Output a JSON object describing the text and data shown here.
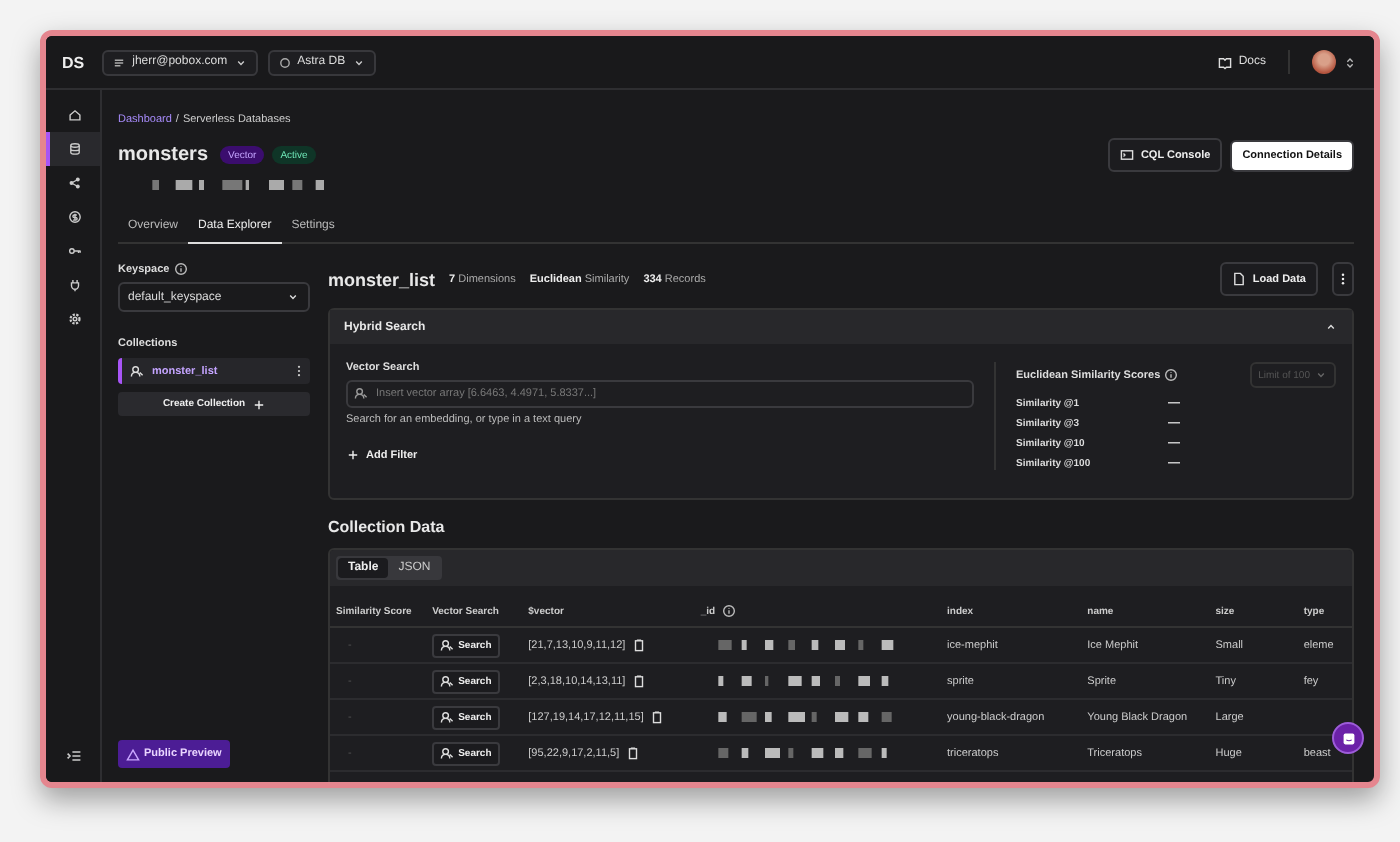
{
  "topbar": {
    "logo": "DS",
    "org": "jherr@pobox.com",
    "db": "Astra DB",
    "docs": "Docs"
  },
  "rail": [
    {
      "selected": false
    },
    {
      "selected": true
    },
    {
      "selected": false
    },
    {
      "selected": false
    },
    {
      "selected": false
    },
    {
      "selected": false
    },
    {
      "selected": false
    }
  ],
  "breadcrumb": {
    "link": "Dashboard",
    "separator": "/",
    "current": "Serverless Databases"
  },
  "database": {
    "name": "monsters",
    "badges": [
      {
        "label": "Vector",
        "kind": "type"
      },
      {
        "label": "Active",
        "kind": "status"
      }
    ]
  },
  "actions": [
    {
      "label": "CQL Console",
      "primary": false
    },
    {
      "label": "Connection Details",
      "primary": true
    }
  ],
  "tabs": [
    {
      "label": "Overview",
      "selected": false
    },
    {
      "label": "Data Explorer",
      "selected": true
    },
    {
      "label": "Settings",
      "selected": false
    }
  ],
  "keyspace": {
    "label": "Keyspace",
    "value": "default_keyspace"
  },
  "collections": {
    "label": "Collections",
    "items": [
      {
        "name": "monster_list",
        "selected": true
      }
    ],
    "create": "Create Collection"
  },
  "collection": {
    "name": "monster_list",
    "stats": [
      "**7** Dimensions",
      "**Euclidean** Similarity",
      "**334** Records"
    ],
    "load": "Load Data"
  },
  "hybrid": {
    "title": "Hybrid Search",
    "expanded": true,
    "vector_label": "Vector Search",
    "placeholder": "Insert vector array [6.6463, 4.4971, 5.8337...]",
    "hint": "Search for an embedding, or type in a text query",
    "add_filter": "Add Filter",
    "scores_title": "Euclidean Similarity Scores",
    "limit": "Limit of 100",
    "scores": [
      {
        "label": "Similarity @1",
        "value": "—"
      },
      {
        "label": "Similarity @3",
        "value": "—"
      },
      {
        "label": "Similarity @10",
        "value": "—"
      },
      {
        "label": "Similarity @100",
        "value": "—"
      }
    ]
  },
  "data": {
    "title": "Collection Data",
    "views": [
      {
        "label": "Table",
        "selected": true
      },
      {
        "label": "JSON",
        "selected": false
      }
    ],
    "columns": [
      "Similarity Score",
      "Vector Search",
      "$vector",
      "_id",
      "index",
      "name",
      "size",
      "type"
    ],
    "rows": [
      {
        "score": "-",
        "action": "Search",
        "vector": "[21,7,13,10,9,11,12]",
        "index": "ice-mephit",
        "name": "Ice Mephit",
        "size": "Small",
        "type": "eleme"
      },
      {
        "score": "-",
        "action": "Search",
        "vector": "[2,3,18,10,14,13,11]",
        "index": "sprite",
        "name": "Sprite",
        "size": "Tiny",
        "type": "fey"
      },
      {
        "score": "-",
        "action": "Search",
        "vector": "[127,19,14,17,12,11,15]",
        "index": "young-black-dragon",
        "name": "Young Black Dragon",
        "size": "Large"
      },
      {
        "score": "-",
        "action": "Search",
        "vector": "[95,22,9,17,2,11,5]",
        "index": "triceratops",
        "name": "Triceratops",
        "size": "Huge",
        "type": "beast"
      }
    ]
  },
  "preview": "Public Preview"
}
